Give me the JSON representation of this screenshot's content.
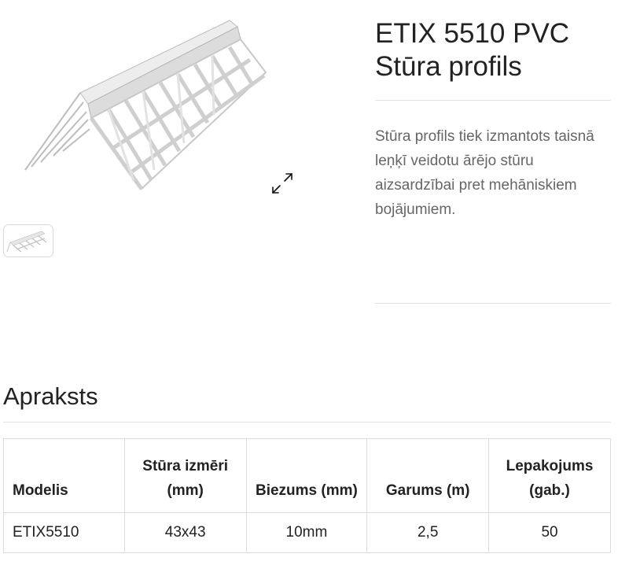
{
  "product": {
    "title_line1": "ETIX 5510 PVC",
    "title_line2": "Stūra profils",
    "description": "Stūra profils tiek izmantots taisnā leņķī veidotu ārējo stūru aizsardzībai pret mehāniskiem bojājumiem.",
    "main_image_icon": "pvc-corner-profile-image",
    "expand_icon": "expand-arrows-icon",
    "thumbnail_icon": "pvc-corner-profile-thumbnail"
  },
  "section": {
    "title": "Apraksts"
  },
  "table": {
    "headers": [
      "Modelis",
      "Stūra izmēri (mm)",
      "Biezums (mm)",
      "Garums (m)",
      "Lepakojums (gab.)"
    ],
    "rows": [
      [
        "ETIX5510",
        "43x43",
        "10mm",
        "2,5",
        "50"
      ]
    ]
  }
}
